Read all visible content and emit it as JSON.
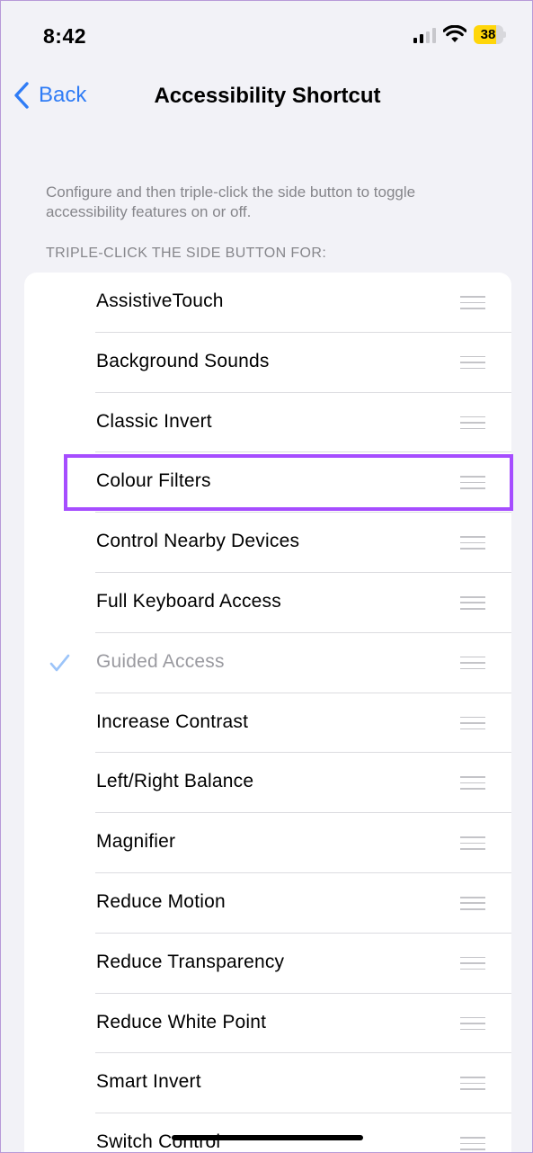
{
  "status_bar": {
    "time": "8:42",
    "battery_level": "38",
    "icons": [
      "signal-icon",
      "wifi-icon",
      "battery-icon"
    ]
  },
  "nav": {
    "back_label": "Back",
    "title": "Accessibility Shortcut",
    "back_icon": "chevron-left-icon"
  },
  "description": "Configure and then triple-click the side button to toggle accessibility features on or off.",
  "section_header": "TRIPLE-CLICK THE SIDE BUTTON FOR:",
  "items": [
    {
      "label": "AssistiveTouch",
      "checked": false
    },
    {
      "label": "Background Sounds",
      "checked": false
    },
    {
      "label": "Classic Invert",
      "checked": false
    },
    {
      "label": "Colour Filters",
      "checked": false
    },
    {
      "label": "Control Nearby Devices",
      "checked": false
    },
    {
      "label": "Full Keyboard Access",
      "checked": false
    },
    {
      "label": "Guided Access",
      "checked": true
    },
    {
      "label": "Increase Contrast",
      "checked": false
    },
    {
      "label": "Left/Right Balance",
      "checked": false
    },
    {
      "label": "Magnifier",
      "checked": false
    },
    {
      "label": "Reduce Motion",
      "checked": false
    },
    {
      "label": "Reduce Transparency",
      "checked": false
    },
    {
      "label": "Reduce White Point",
      "checked": false
    },
    {
      "label": "Smart Invert",
      "checked": false
    },
    {
      "label": "Switch Control",
      "checked": false
    }
  ],
  "colors": {
    "accent": "#2f7cf6",
    "highlight": "#a64dff",
    "battery": "#ffd60a"
  }
}
